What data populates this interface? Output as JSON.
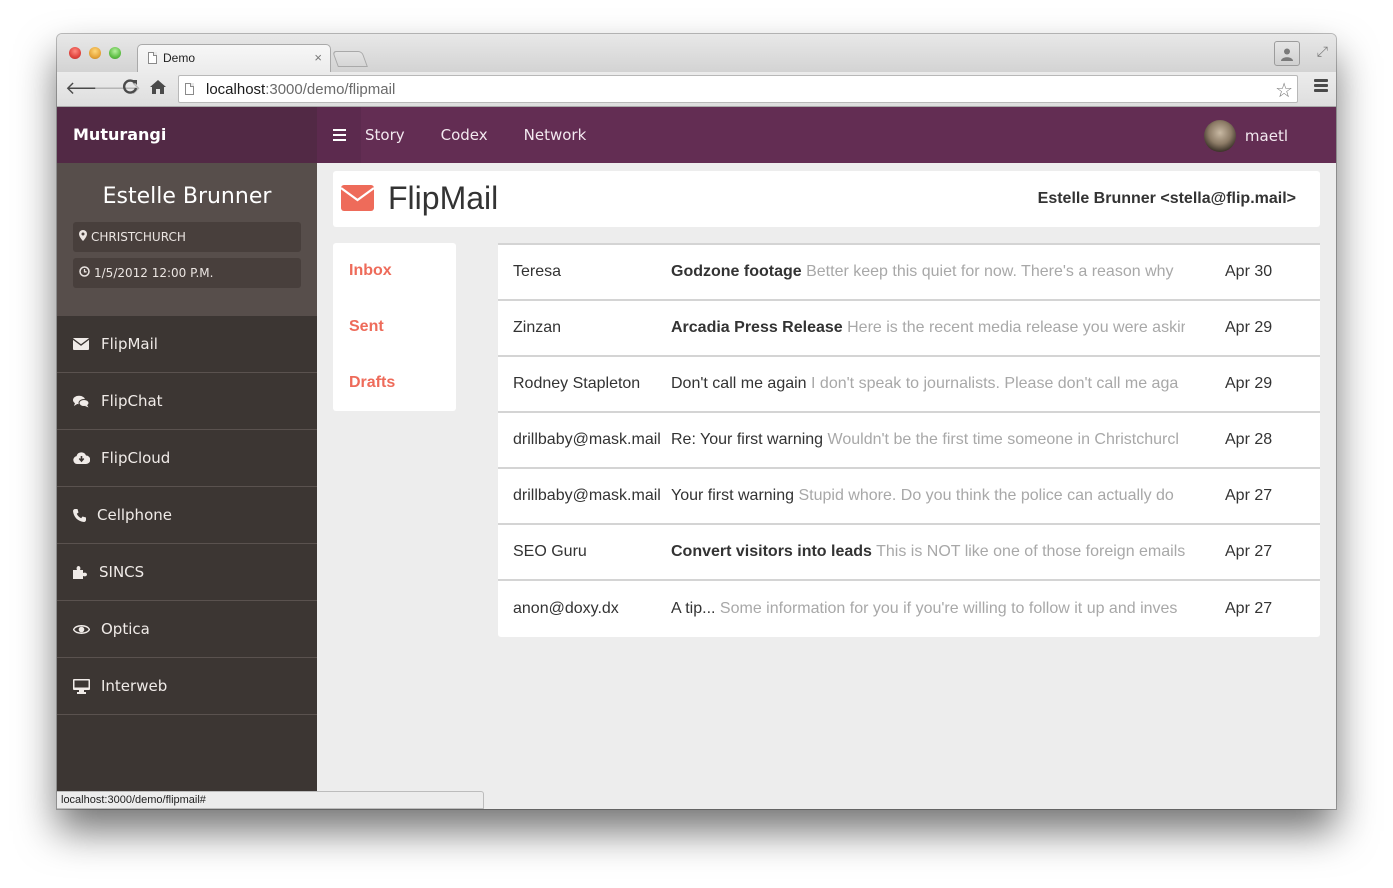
{
  "browser": {
    "tab_title": "Demo",
    "url_host": "localhost",
    "url_rest": ":3000/demo/flipmail",
    "status_url": "localhost:3000/demo/flipmail#"
  },
  "navbar": {
    "brand": "Muturangi",
    "links": [
      "Story",
      "Codex",
      "Network"
    ],
    "username": "maetl"
  },
  "profile": {
    "name": "Estelle Brunner",
    "location": "CHRISTCHURCH",
    "datetime": "1/5/2012 12:00 P.M."
  },
  "sidebar": {
    "items": [
      {
        "label": "FlipMail",
        "icon": "envelope-icon"
      },
      {
        "label": "FlipChat",
        "icon": "comments-icon"
      },
      {
        "label": "FlipCloud",
        "icon": "cloud-download-icon"
      },
      {
        "label": "Cellphone",
        "icon": "phone-icon"
      },
      {
        "label": "SINCS",
        "icon": "puzzle-icon"
      },
      {
        "label": "Optica",
        "icon": "eye-icon"
      },
      {
        "label": "Interweb",
        "icon": "desktop-icon"
      }
    ]
  },
  "mail": {
    "title": "FlipMail",
    "account": "Estelle Brunner <stella@flip.mail>",
    "accent": "#ee6b5a",
    "folders": [
      "Inbox",
      "Sent",
      "Drafts"
    ],
    "messages": [
      {
        "from": "Teresa",
        "subject": "Godzone footage",
        "preview": "Better keep this quiet for now. There's a reason why",
        "date": "Apr 30",
        "unread": true
      },
      {
        "from": "Zinzan",
        "subject": "Arcadia Press Release",
        "preview": "Here is the recent media release you were askir",
        "date": "Apr 29",
        "unread": true
      },
      {
        "from": "Rodney Stapleton",
        "subject": "Don't call me again",
        "preview": "I don't speak to journalists. Please don't call me aga",
        "date": "Apr 29",
        "unread": false
      },
      {
        "from": "drillbaby@mask.mail",
        "subject": "Re: Your first warning",
        "preview": "Wouldn't be the first time someone in Christchurcl",
        "date": "Apr 28",
        "unread": false
      },
      {
        "from": "drillbaby@mask.mail",
        "subject": "Your first warning",
        "preview": "Stupid whore. Do you think the police can actually do",
        "date": "Apr 27",
        "unread": false
      },
      {
        "from": "SEO Guru",
        "subject": "Convert visitors into leads",
        "preview": "This is NOT like one of those foreign emails",
        "date": "Apr 27",
        "unread": true
      },
      {
        "from": "anon@doxy.dx",
        "subject": "A tip...",
        "preview": "Some information for you if you're willing to follow it up and inves",
        "date": "Apr 27",
        "unread": false
      }
    ]
  }
}
